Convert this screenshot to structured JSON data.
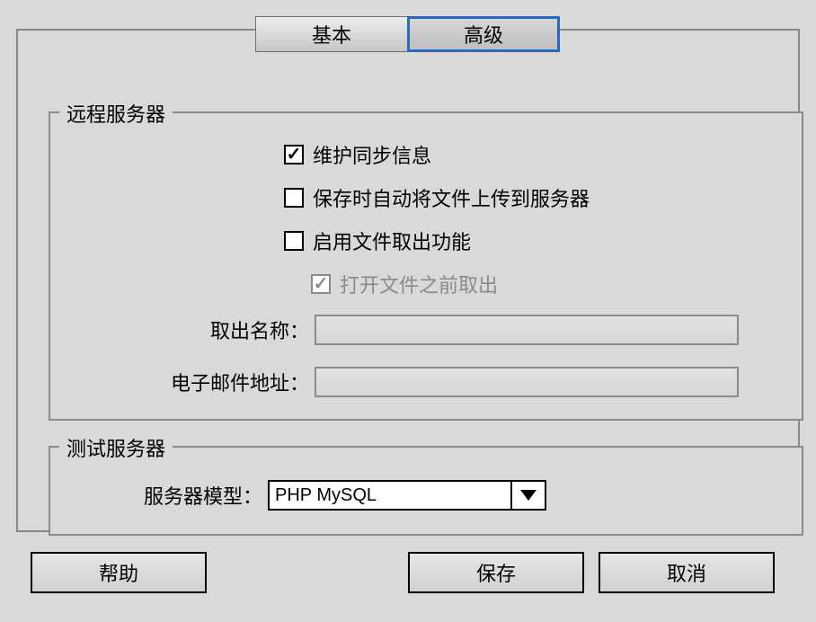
{
  "tabs": {
    "basic": "基本",
    "advanced": "高级"
  },
  "remote": {
    "legend": "远程服务器",
    "chk_syncinfo": "维护同步信息",
    "chk_autoupload": "保存时自动将文件上传到服务器",
    "chk_enablecheckout": "启用文件取出功能",
    "chk_checkoutbefore": "打开文件之前取出",
    "label_name": "取出名称：",
    "label_email": "电子邮件地址：",
    "name_value": "",
    "email_value": ""
  },
  "test": {
    "legend": "测试服务器",
    "label_model": "服务器模型：",
    "model_value": "PHP MySQL"
  },
  "buttons": {
    "help": "帮助",
    "save": "保存",
    "cancel": "取消"
  }
}
